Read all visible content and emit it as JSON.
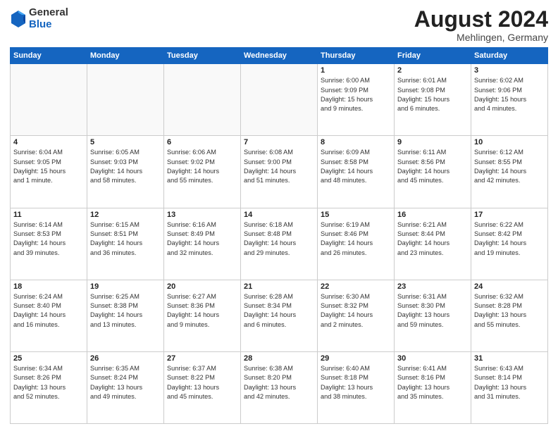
{
  "header": {
    "logo_general": "General",
    "logo_blue": "Blue",
    "month": "August 2024",
    "location": "Mehlingen, Germany"
  },
  "weekdays": [
    "Sunday",
    "Monday",
    "Tuesday",
    "Wednesday",
    "Thursday",
    "Friday",
    "Saturday"
  ],
  "weeks": [
    [
      {
        "day": "",
        "info": ""
      },
      {
        "day": "",
        "info": ""
      },
      {
        "day": "",
        "info": ""
      },
      {
        "day": "",
        "info": ""
      },
      {
        "day": "1",
        "info": "Sunrise: 6:00 AM\nSunset: 9:09 PM\nDaylight: 15 hours\nand 9 minutes."
      },
      {
        "day": "2",
        "info": "Sunrise: 6:01 AM\nSunset: 9:08 PM\nDaylight: 15 hours\nand 6 minutes."
      },
      {
        "day": "3",
        "info": "Sunrise: 6:02 AM\nSunset: 9:06 PM\nDaylight: 15 hours\nand 4 minutes."
      }
    ],
    [
      {
        "day": "4",
        "info": "Sunrise: 6:04 AM\nSunset: 9:05 PM\nDaylight: 15 hours\nand 1 minute."
      },
      {
        "day": "5",
        "info": "Sunrise: 6:05 AM\nSunset: 9:03 PM\nDaylight: 14 hours\nand 58 minutes."
      },
      {
        "day": "6",
        "info": "Sunrise: 6:06 AM\nSunset: 9:02 PM\nDaylight: 14 hours\nand 55 minutes."
      },
      {
        "day": "7",
        "info": "Sunrise: 6:08 AM\nSunset: 9:00 PM\nDaylight: 14 hours\nand 51 minutes."
      },
      {
        "day": "8",
        "info": "Sunrise: 6:09 AM\nSunset: 8:58 PM\nDaylight: 14 hours\nand 48 minutes."
      },
      {
        "day": "9",
        "info": "Sunrise: 6:11 AM\nSunset: 8:56 PM\nDaylight: 14 hours\nand 45 minutes."
      },
      {
        "day": "10",
        "info": "Sunrise: 6:12 AM\nSunset: 8:55 PM\nDaylight: 14 hours\nand 42 minutes."
      }
    ],
    [
      {
        "day": "11",
        "info": "Sunrise: 6:14 AM\nSunset: 8:53 PM\nDaylight: 14 hours\nand 39 minutes."
      },
      {
        "day": "12",
        "info": "Sunrise: 6:15 AM\nSunset: 8:51 PM\nDaylight: 14 hours\nand 36 minutes."
      },
      {
        "day": "13",
        "info": "Sunrise: 6:16 AM\nSunset: 8:49 PM\nDaylight: 14 hours\nand 32 minutes."
      },
      {
        "day": "14",
        "info": "Sunrise: 6:18 AM\nSunset: 8:48 PM\nDaylight: 14 hours\nand 29 minutes."
      },
      {
        "day": "15",
        "info": "Sunrise: 6:19 AM\nSunset: 8:46 PM\nDaylight: 14 hours\nand 26 minutes."
      },
      {
        "day": "16",
        "info": "Sunrise: 6:21 AM\nSunset: 8:44 PM\nDaylight: 14 hours\nand 23 minutes."
      },
      {
        "day": "17",
        "info": "Sunrise: 6:22 AM\nSunset: 8:42 PM\nDaylight: 14 hours\nand 19 minutes."
      }
    ],
    [
      {
        "day": "18",
        "info": "Sunrise: 6:24 AM\nSunset: 8:40 PM\nDaylight: 14 hours\nand 16 minutes."
      },
      {
        "day": "19",
        "info": "Sunrise: 6:25 AM\nSunset: 8:38 PM\nDaylight: 14 hours\nand 13 minutes."
      },
      {
        "day": "20",
        "info": "Sunrise: 6:27 AM\nSunset: 8:36 PM\nDaylight: 14 hours\nand 9 minutes."
      },
      {
        "day": "21",
        "info": "Sunrise: 6:28 AM\nSunset: 8:34 PM\nDaylight: 14 hours\nand 6 minutes."
      },
      {
        "day": "22",
        "info": "Sunrise: 6:30 AM\nSunset: 8:32 PM\nDaylight: 14 hours\nand 2 minutes."
      },
      {
        "day": "23",
        "info": "Sunrise: 6:31 AM\nSunset: 8:30 PM\nDaylight: 13 hours\nand 59 minutes."
      },
      {
        "day": "24",
        "info": "Sunrise: 6:32 AM\nSunset: 8:28 PM\nDaylight: 13 hours\nand 55 minutes."
      }
    ],
    [
      {
        "day": "25",
        "info": "Sunrise: 6:34 AM\nSunset: 8:26 PM\nDaylight: 13 hours\nand 52 minutes."
      },
      {
        "day": "26",
        "info": "Sunrise: 6:35 AM\nSunset: 8:24 PM\nDaylight: 13 hours\nand 49 minutes."
      },
      {
        "day": "27",
        "info": "Sunrise: 6:37 AM\nSunset: 8:22 PM\nDaylight: 13 hours\nand 45 minutes."
      },
      {
        "day": "28",
        "info": "Sunrise: 6:38 AM\nSunset: 8:20 PM\nDaylight: 13 hours\nand 42 minutes."
      },
      {
        "day": "29",
        "info": "Sunrise: 6:40 AM\nSunset: 8:18 PM\nDaylight: 13 hours\nand 38 minutes."
      },
      {
        "day": "30",
        "info": "Sunrise: 6:41 AM\nSunset: 8:16 PM\nDaylight: 13 hours\nand 35 minutes."
      },
      {
        "day": "31",
        "info": "Sunrise: 6:43 AM\nSunset: 8:14 PM\nDaylight: 13 hours\nand 31 minutes."
      }
    ]
  ]
}
